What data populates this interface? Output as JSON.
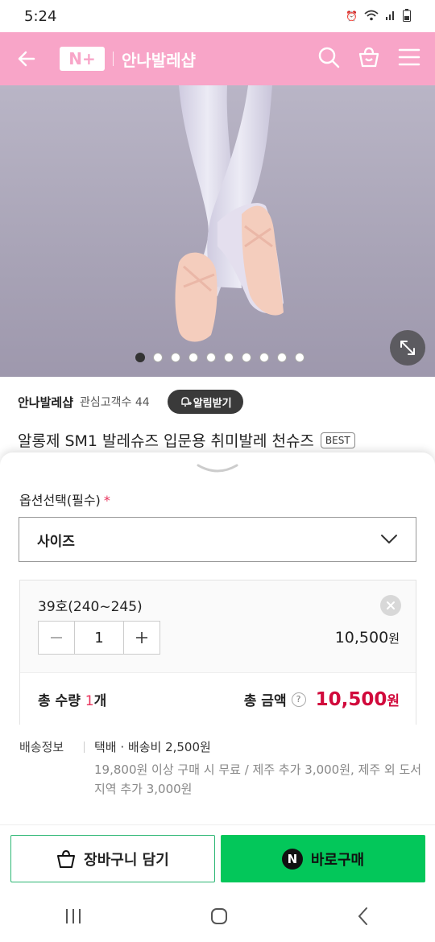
{
  "status": {
    "time": "5:24"
  },
  "appbar": {
    "brand_badge": "N+",
    "shop_name": "안나발레샵"
  },
  "hero": {
    "dot_count": 10,
    "active_dot": 0
  },
  "seller": {
    "name": "안나발레샵",
    "fans": "관심고객수 44",
    "notify_label": "알림받기"
  },
  "product": {
    "title": "알롱제 SM1 발레슈즈 입문용 취미발레 천슈즈",
    "badge": "BEST"
  },
  "options": {
    "label": "옵션선택(필수)",
    "required_mark": "*",
    "select_value": "사이즈",
    "selected_item": {
      "name": "39호(240~245)",
      "quantity": "1",
      "price": "10,500",
      "price_unit": "원"
    },
    "total": {
      "qty_prefix": "총 수량 ",
      "qty_value": "1",
      "qty_suffix": "개",
      "amount_label": "총 금액",
      "help": "?",
      "amount": "10,500",
      "amount_unit": "원"
    }
  },
  "shipping": {
    "label": "배송정보",
    "main": "택배 · 배송비 2,500원",
    "sub": "19,800원 이상 구매 시 무료 / 제주 추가 3,000원, 제주 외 도서지역 추가 3,000원"
  },
  "actions": {
    "cart_label": "장바구니 담기",
    "buy_label": "바로구매",
    "npay_mark": "N"
  },
  "colors": {
    "brand_pink": "#f8a5c8",
    "naver_green": "#03c75a",
    "price_red": "#d10a3c"
  }
}
